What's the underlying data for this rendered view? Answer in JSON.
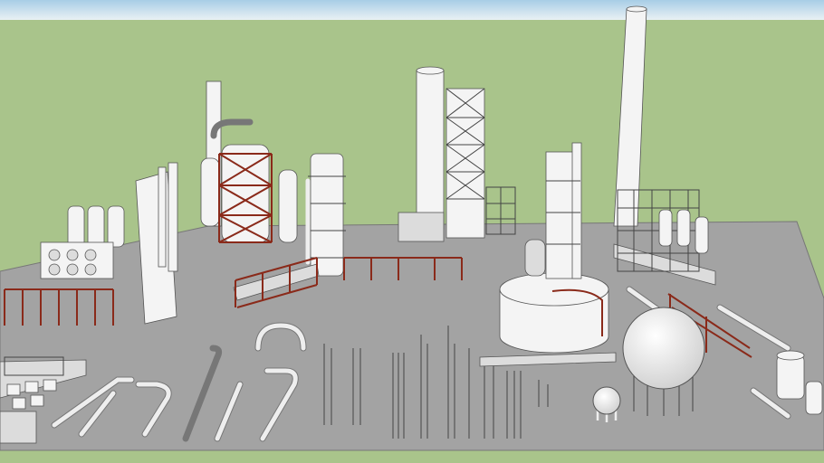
{
  "scene": {
    "colors": {
      "sky_top": "#a8cde6",
      "sky_bottom": "#e9f1f4",
      "ground": "#a9c48b",
      "platform": "#a3a3a3",
      "equipment": "#f4f4f4",
      "steel_frame": "#8a2a1a"
    }
  }
}
